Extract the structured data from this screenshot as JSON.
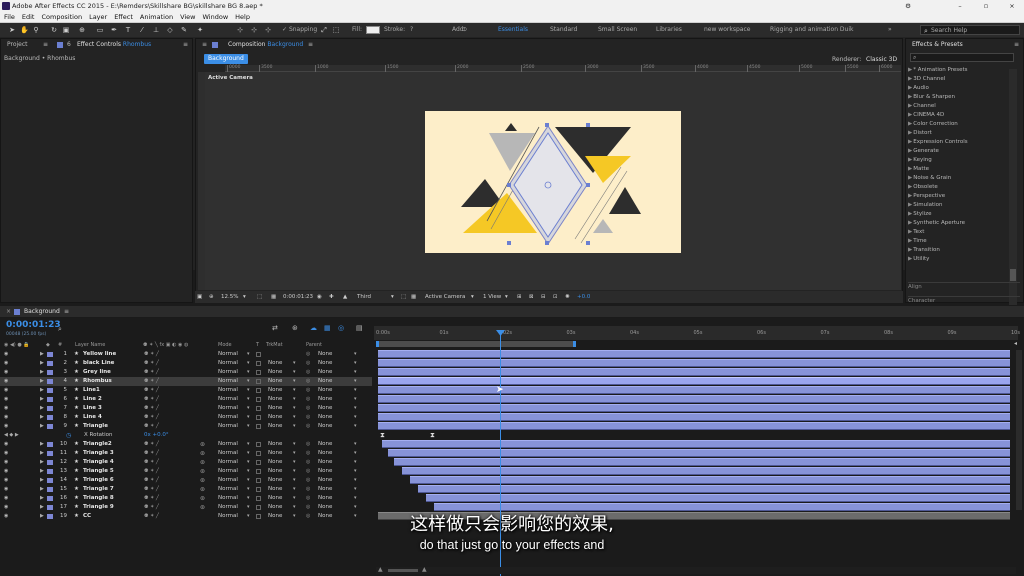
{
  "title_bar": {
    "text": "Adobe After Effects CC 2015 - E:\\Remders\\Skillshare BG\\skillshare BG 8.aep *",
    "minimize": "–",
    "maximize": "▫",
    "close": "×"
  },
  "menu": [
    "File",
    "Edit",
    "Composition",
    "Layer",
    "Effect",
    "Animation",
    "View",
    "Window",
    "Help"
  ],
  "toolbar": {
    "snapping": "Snapping",
    "fill": "Fill:",
    "stroke": "Stroke:",
    "add": "Add:",
    "help_q": "?"
  },
  "workspaces": [
    "Essentials",
    "Standard",
    "Small Screen",
    "Libraries",
    "new workspace",
    "Rigging and animation Duik"
  ],
  "search": {
    "placeholder": "Search Help"
  },
  "left_panel": {
    "tab_project": "Project",
    "tab_effect_controls": "Effect Controls",
    "effect_controls_target": "Rhombus",
    "breadcrumb": "Background • Rhombus"
  },
  "comp_panel": {
    "tab_prefix": "Composition",
    "comp_name": "Background",
    "subtab": "Background",
    "renderer_label": "Renderer:",
    "renderer_value": "Classic 3D",
    "active_camera": "Active Camera"
  },
  "ruler_ticks": [
    "0000",
    "3500",
    "1000",
    "1500",
    "2000",
    "2500",
    "3000",
    "3500",
    "4000",
    "4500",
    "5000",
    "5500",
    "6000"
  ],
  "viewer_bar": {
    "zoom": "12.5%",
    "timecode": "0:00:01:23",
    "third": "Third",
    "camera": "Active Camera",
    "view": "1 View",
    "exposure": "+0.0"
  },
  "effects_panel": {
    "title": "Effects & Presets",
    "items": [
      "* Animation Presets",
      "3D Channel",
      "Audio",
      "Blur & Sharpen",
      "Channel",
      "CINEMA 4D",
      "Color Correction",
      "Distort",
      "Expression Controls",
      "Generate",
      "Keying",
      "Matte",
      "Noise & Grain",
      "Obsolete",
      "Perspective",
      "Simulation",
      "Stylize",
      "Synthetic Aperture",
      "Text",
      "Time",
      "Transition",
      "Utility"
    ],
    "align": "Align",
    "character": "Character"
  },
  "timeline": {
    "tab": "Background",
    "timecode": "0:00:01:23",
    "fps": "00048 (25.00 fps)",
    "col_layer_name": "Layer Name",
    "col_mode": "Mode",
    "col_t": "T",
    "col_trkmat": "TrkMat",
    "col_parent": "Parent",
    "ruler": [
      "0:00s",
      "01s",
      "02s",
      "03s",
      "04s",
      "05s",
      "06s",
      "07s",
      "08s",
      "09s",
      "10s"
    ],
    "xrotation": {
      "label": "X Rotation",
      "value": "0x +0.0°"
    },
    "layers": [
      {
        "num": "1",
        "name": "Yellow line",
        "mode": "Normal",
        "trk": "",
        "parent": "None"
      },
      {
        "num": "2",
        "name": "black Line",
        "mode": "Normal",
        "trk": "None",
        "parent": "None"
      },
      {
        "num": "3",
        "name": "Grey line",
        "mode": "Normal",
        "trk": "None",
        "parent": "None"
      },
      {
        "num": "4",
        "name": "Rhombus",
        "mode": "Normal",
        "trk": "None",
        "parent": "None"
      },
      {
        "num": "5",
        "name": "Line1",
        "mode": "Normal",
        "trk": "None",
        "parent": "None"
      },
      {
        "num": "6",
        "name": "Line 2",
        "mode": "Normal",
        "trk": "None",
        "parent": "None"
      },
      {
        "num": "7",
        "name": "Line 3",
        "mode": "Normal",
        "trk": "None",
        "parent": "None"
      },
      {
        "num": "8",
        "name": "Line 4",
        "mode": "Normal",
        "trk": "None",
        "parent": "None"
      },
      {
        "num": "9",
        "name": "Triangle",
        "mode": "Normal",
        "trk": "None",
        "parent": "None"
      },
      {
        "num": "10",
        "name": "Triangle2",
        "mode": "Normal",
        "trk": "None",
        "parent": "None"
      },
      {
        "num": "11",
        "name": "Triangle 3",
        "mode": "Normal",
        "trk": "None",
        "parent": "None"
      },
      {
        "num": "12",
        "name": "Triangle 4",
        "mode": "Normal",
        "trk": "None",
        "parent": "None"
      },
      {
        "num": "13",
        "name": "Triangle 5",
        "mode": "Normal",
        "trk": "None",
        "parent": "None"
      },
      {
        "num": "14",
        "name": "Triangle 6",
        "mode": "Normal",
        "trk": "None",
        "parent": "None"
      },
      {
        "num": "15",
        "name": "Triangle 7",
        "mode": "Normal",
        "trk": "None",
        "parent": "None"
      },
      {
        "num": "16",
        "name": "Triangle 8",
        "mode": "Normal",
        "trk": "None",
        "parent": "None"
      },
      {
        "num": "17",
        "name": "Triangle 9",
        "mode": "Normal",
        "trk": "None",
        "parent": "None"
      },
      {
        "num": "19",
        "name": "CC",
        "mode": "Normal",
        "trk": "None",
        "parent": "None"
      }
    ]
  },
  "subtitle": {
    "cn": "这样做只会影响您的效果,",
    "en": "do that just go to your effects and"
  },
  "colors": {
    "accent": "#3b8ee6",
    "layer_bar": "#8793d8",
    "label": "#7d86d4",
    "canvas": "#fdeec9",
    "yellow": "#f5c825",
    "dark": "#2d2d2d",
    "grey": "#b7b7b7"
  }
}
